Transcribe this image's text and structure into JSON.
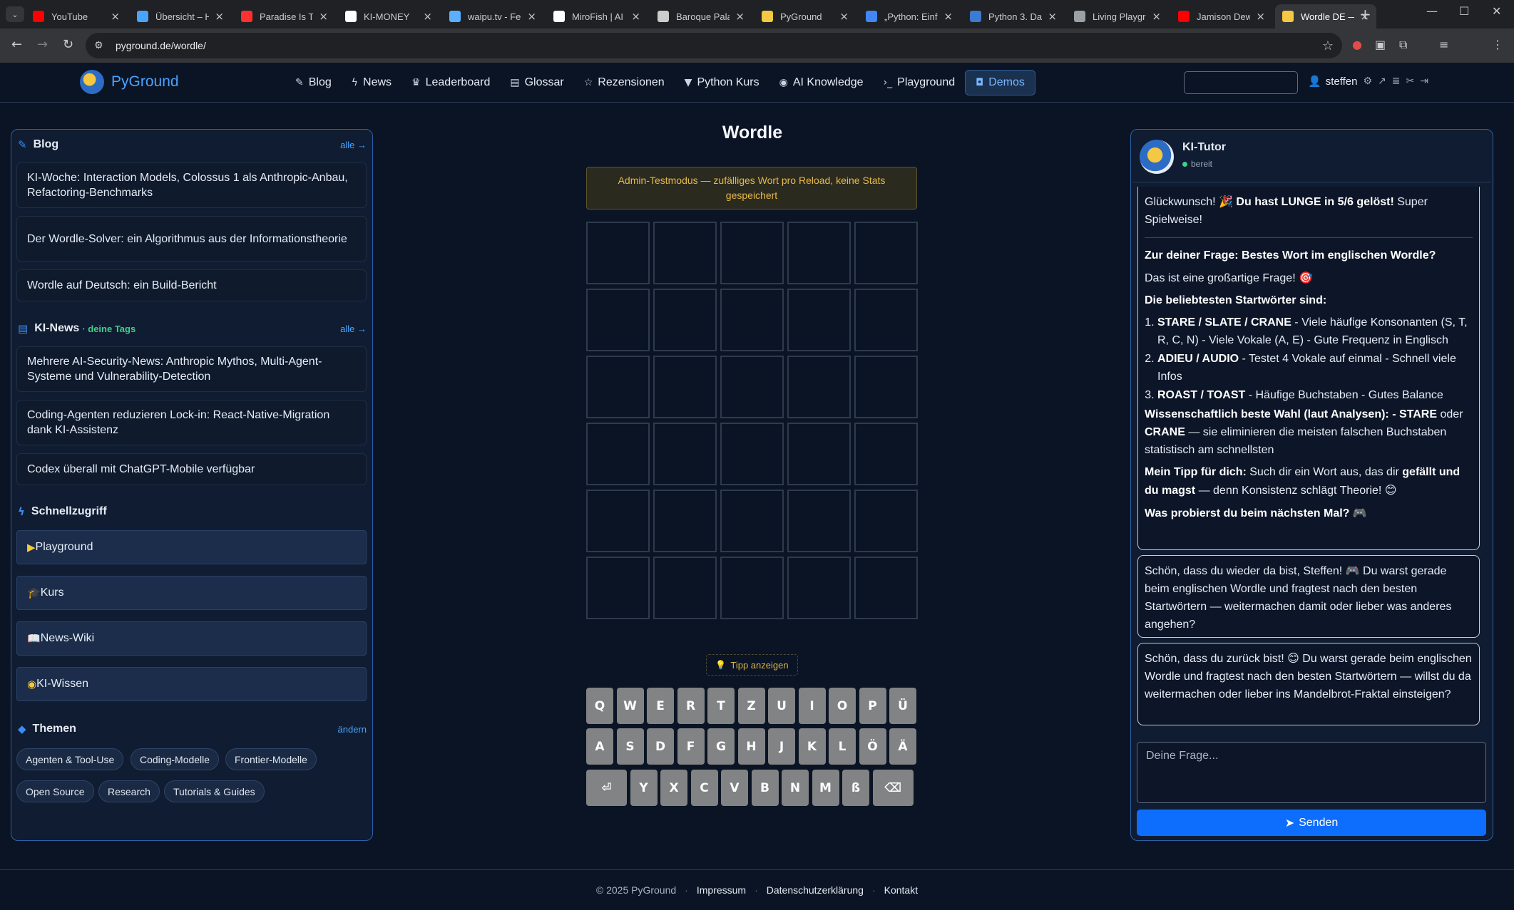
{
  "browser": {
    "tabs": [
      {
        "label": "YouTube",
        "icon": "youtube-icon",
        "color": "#ff0000"
      },
      {
        "label": "Übersicht – H",
        "icon": "home-icon",
        "color": "#4aa3ff"
      },
      {
        "label": "Paradise Is Th",
        "icon": "youtube-music-icon",
        "color": "#ff3030"
      },
      {
        "label": "KI-MONEY",
        "icon": "ki-icon",
        "color": "#ffffff"
      },
      {
        "label": "waipu.tv - Fe",
        "icon": "waipu-icon",
        "color": "#5ab0ff"
      },
      {
        "label": "MiroFish | AI",
        "icon": "triangle-icon",
        "color": "#ffffff"
      },
      {
        "label": "Baroque Pala",
        "icon": "link-icon",
        "color": "#cccccc"
      },
      {
        "label": "PyGround",
        "icon": "pyground-icon",
        "color": "#f4c842"
      },
      {
        "label": "„Python: Einf",
        "icon": "google-icon",
        "color": "#4285f4"
      },
      {
        "label": "Python 3. Da",
        "icon": "python-icon",
        "color": "#3b7bd0"
      },
      {
        "label": "Living Playgr",
        "icon": "globe-icon",
        "color": "#9aa0a6"
      },
      {
        "label": "Jamison Dew",
        "icon": "youtube-icon",
        "color": "#ff0000"
      },
      {
        "label": "Wordle DE —",
        "icon": "pyground-icon",
        "color": "#f4c842"
      }
    ],
    "url": "pyground.de/wordle/"
  },
  "site": {
    "logo_text": "PyGround",
    "nav": [
      {
        "label": "Blog",
        "icon": "pen-icon",
        "glyph": "✎"
      },
      {
        "label": "News",
        "icon": "bolt-icon",
        "glyph": "ϟ"
      },
      {
        "label": "Leaderboard",
        "icon": "trophy-icon",
        "glyph": "♛"
      },
      {
        "label": "Glossar",
        "icon": "book-icon",
        "glyph": "▤"
      },
      {
        "label": "Rezensionen",
        "icon": "star-icon",
        "glyph": "☆"
      },
      {
        "label": "Python Kurs",
        "icon": "graduation-cap-icon",
        "glyph": "▼"
      },
      {
        "label": "AI Knowledge",
        "icon": "brain-icon",
        "glyph": "◉"
      },
      {
        "label": "Playground",
        "icon": "terminal-icon",
        "glyph": "›_"
      },
      {
        "label": "Demos",
        "icon": "gamepad-icon",
        "glyph": "◘"
      }
    ],
    "active_nav": "Demos",
    "username": "steffen"
  },
  "sidebar": {
    "blog": {
      "title": "Blog",
      "more": "alle →",
      "posts": [
        "KI-Woche: Interaction Models, Colossus 1 als Anthropic-Anbau, Refactoring-Benchmarks",
        "Der Wordle-Solver: ein Algorithmus aus der Informationstheorie",
        "Wordle auf Deutsch: ein Build-Bericht"
      ]
    },
    "news": {
      "title": "KI-News",
      "tag_note": "· deine Tags",
      "more": "alle →",
      "items": [
        "Mehrere AI-Security-News: Anthropic Mythos, Multi-Agent-Systeme und Vulnerability-Detection",
        "Coding-Agenten reduzieren Lock-in: React-Native-Migration dank KI-Assistenz",
        "Codex überall mit ChatGPT-Mobile verfügbar"
      ]
    },
    "quick": {
      "title": "Schnellzugriff",
      "items": [
        {
          "label": "Playground",
          "glyph": "▶"
        },
        {
          "label": "Kurs",
          "glyph": "🎓"
        },
        {
          "label": "News-Wiki",
          "glyph": "📖"
        },
        {
          "label": "KI-Wissen",
          "glyph": "◉"
        }
      ]
    },
    "themes": {
      "title": "Themen",
      "edit": "ändern",
      "tags": [
        "Agenten & Tool-Use",
        "Coding-Modelle",
        "Frontier-Modelle",
        "Open Source",
        "Research",
        "Tutorials & Guides"
      ]
    }
  },
  "wordle": {
    "title": "Wordle",
    "admin_note": "Admin-Testmodus — zufälliges Wort pro Reload, keine Stats gespeichert",
    "hint": "Tipp anzeigen",
    "rows": 6,
    "cols": 5,
    "keyboard": [
      [
        "Q",
        "W",
        "E",
        "R",
        "T",
        "Z",
        "U",
        "I",
        "O",
        "P",
        "Ü"
      ],
      [
        "A",
        "S",
        "D",
        "F",
        "G",
        "H",
        "J",
        "K",
        "L",
        "Ö",
        "Ä"
      ],
      [
        "⏎",
        "Y",
        "X",
        "C",
        "V",
        "B",
        "N",
        "M",
        "ß",
        "⌫"
      ]
    ]
  },
  "tutor": {
    "name": "KI-Tutor",
    "status": "bereit",
    "message1": {
      "congrats_pre": "Glückwunsch! ",
      "congrats_emoji": "🎉",
      "congrats_bold": "Du hast LUNGE in 5/6 gelöst!",
      "congrats_post": " Super Spielweise!",
      "question_heading": "Zur deiner Frage: Bestes Wort im englischen Wordle?",
      "great_question": "Das ist eine großartige Frage! ",
      "great_emoji": "🎯",
      "popular_heading": "Die beliebtesten Startwörter sind:",
      "list": [
        {
          "bold": "STARE / SLATE / CRANE",
          "text": " - Viele häufige Konsonanten (S, T, R, C, N) - Viele Vokale (A, E) - Gute Frequenz in Englisch"
        },
        {
          "bold": "ADIEU / AUDIO",
          "text": " - Testet 4 Vokale auf einmal - Schnell viele Infos"
        },
        {
          "bold": "ROAST / TOAST",
          "text": " - Häufige Buchstaben - Gutes Balance"
        }
      ],
      "science_bold": "Wissenschaftlich beste Wahl (laut Analysen): - STARE",
      "science_or": " oder ",
      "science_crane": "CRANE",
      "science_rest": " — sie eliminieren die meisten falschen Buchstaben statistisch am schnellsten",
      "tip_bold": "Mein Tipp für dich:",
      "tip_text": " Such dir ein Wort aus, das dir ",
      "tip_bold2": "gefällt und du magst",
      "tip_rest": " — denn Konsistenz schlägt Theorie! ",
      "tip_emoji": "😊",
      "next_bold": "Was probierst du beim nächsten Mal? ",
      "next_emoji": "🎮"
    },
    "message2": {
      "text": "Schön, dass du wieder da bist, Steffen! ",
      "emoji": "🎮",
      "rest": " Du warst gerade beim englischen Wordle und fragtest nach den besten Startwörtern — weitermachen damit oder lieber was anderes angehen?"
    },
    "message3": {
      "text": "Schön, dass du zurück bist! ",
      "emoji": "😊",
      "rest": " Du warst gerade beim englischen Wordle und fragtest nach den besten Startwörtern — willst du da weitermachen oder lieber ins Mandelbrot-Fraktal einsteigen?"
    },
    "input_placeholder": "Deine Frage...",
    "send": "Senden"
  },
  "footer": {
    "copyright": "© 2025 PyGround",
    "links": [
      "Impressum",
      "Datenschutzerklärung",
      "Kontakt"
    ]
  }
}
